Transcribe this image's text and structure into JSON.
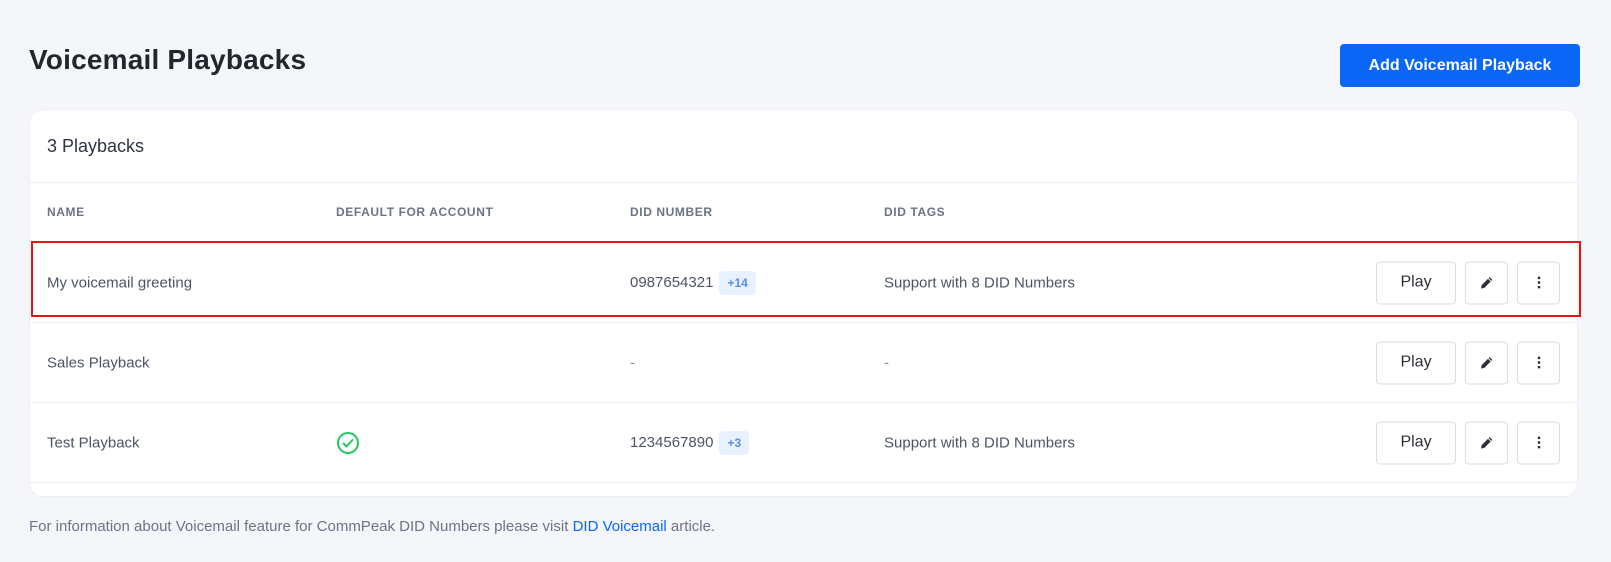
{
  "header": {
    "title": "Voicemail Playbacks",
    "add_button_label": "Add Voicemail Playback"
  },
  "card": {
    "count_label": "3 Playbacks"
  },
  "table": {
    "columns": [
      "NAME",
      "DEFAULT FOR ACCOUNT",
      "DID NUMBER",
      "DID TAGS"
    ],
    "rows": [
      {
        "name": "My voicemail greeting",
        "is_default": false,
        "did_number": "0987654321",
        "did_extra": "+14",
        "did_tags": "Support with 8 DID Numbers",
        "highlighted": true
      },
      {
        "name": "Sales Playback",
        "is_default": false,
        "did_number": "-",
        "did_extra": "",
        "did_tags": "-",
        "highlighted": false
      },
      {
        "name": "Test Playback",
        "is_default": true,
        "did_number": "1234567890",
        "did_extra": "+3",
        "did_tags": "Support with 8 DID Numbers",
        "highlighted": false
      }
    ],
    "play_label": "Play",
    "icons": {
      "edit": "pencil-icon",
      "more": "more-vertical-icon",
      "default": "check-circle-icon"
    }
  },
  "footer": {
    "text_before": "For information about Voicemail feature for CommPeak DID Numbers please visit ",
    "link_text": "DID Voicemail",
    "text_after": " article."
  },
  "colors": {
    "accent": "#0a66f5",
    "check": "#22c55e",
    "highlight": "#e01515"
  }
}
